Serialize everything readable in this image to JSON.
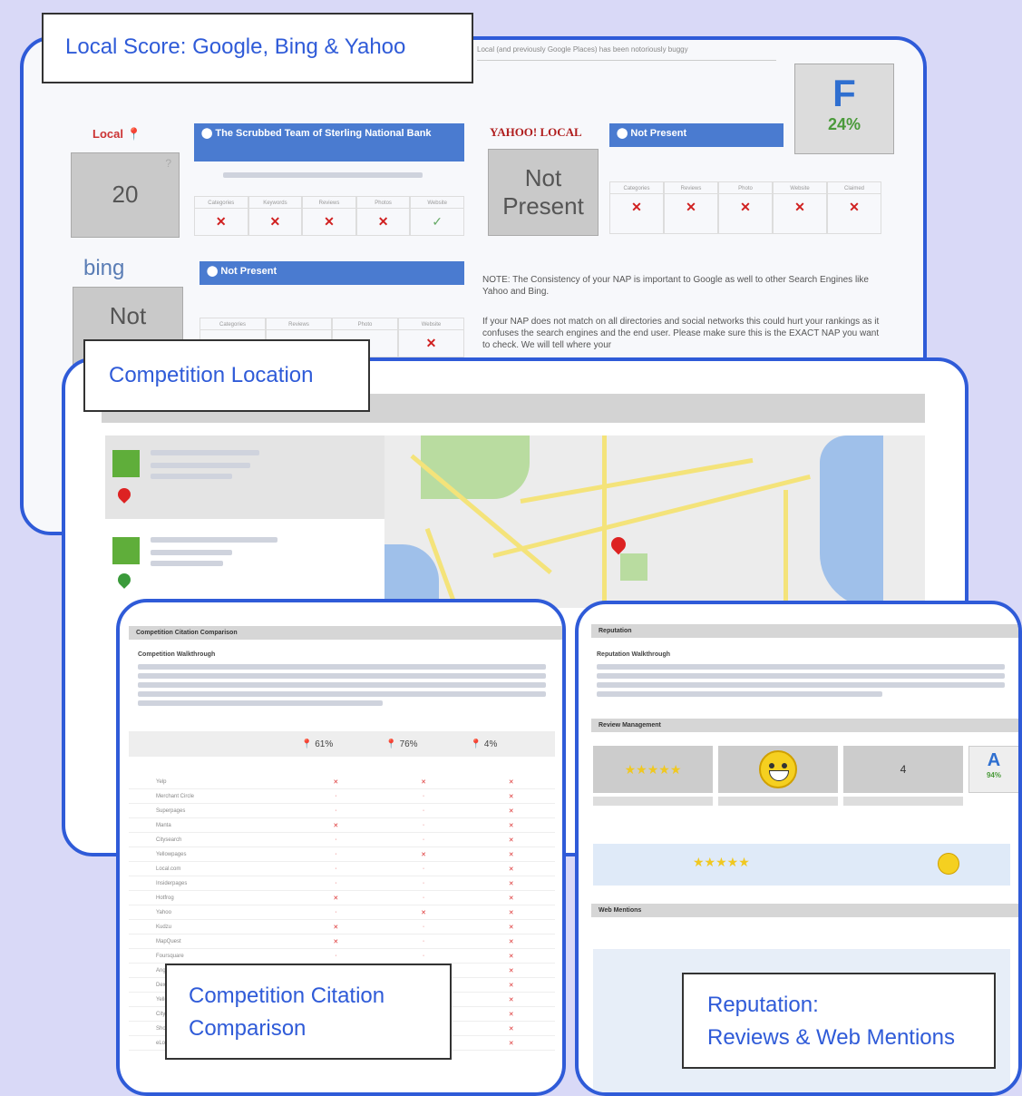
{
  "local_panel": {
    "label": "Local Score: Google, Bing & Yahoo",
    "grade": "F",
    "grade_pct": "24%",
    "google_logo": "Local",
    "google_score": "20",
    "google_bar": "The Scrubbed Team of Sterling National Bank",
    "yahoo_logo": "YAHOO! LOCAL",
    "yahoo_status": [
      "Not",
      "Present"
    ],
    "yahoo_bar": "Not Present",
    "bing_logo": "bing",
    "bing_status": "Not",
    "bing_bar": "Not Present",
    "note_1": "NOTE: The Consistency of your NAP is important to Google as well to other Search Engines like Yahoo and Bing.",
    "note_2": "If your NAP does not match on all directories and social networks this could hurt your rankings as it confuses the search engines and the end user. Please make sure this is the EXACT NAP you want to check. We will tell where your",
    "top_text": "Local (and previously Google Places) has been notoriously buggy"
  },
  "competition_location": {
    "label": "Competition Location"
  },
  "citation_panel": {
    "label_line1": "Competition Citation",
    "label_line2": "Comparison",
    "header": "Competition Citation Comparison",
    "title": "Competition Walkthrough",
    "pct_1": "61%",
    "pct_2": "76%",
    "pct_3": "4%"
  },
  "reputation_panel": {
    "label_line1": "Reputation:",
    "label_line2": "Reviews & Web Mentions",
    "header": "Reputation",
    "title": "Reputation Walkthrough",
    "reviews_header": "Review Management",
    "review_count": "4",
    "grade": "A",
    "grade_pct": "94%",
    "mentions_header": "Web Mentions"
  },
  "colors": {
    "frame_border": "#2f5bd8",
    "label_text": "#2f5bd8",
    "background": "#d9d9f7"
  }
}
